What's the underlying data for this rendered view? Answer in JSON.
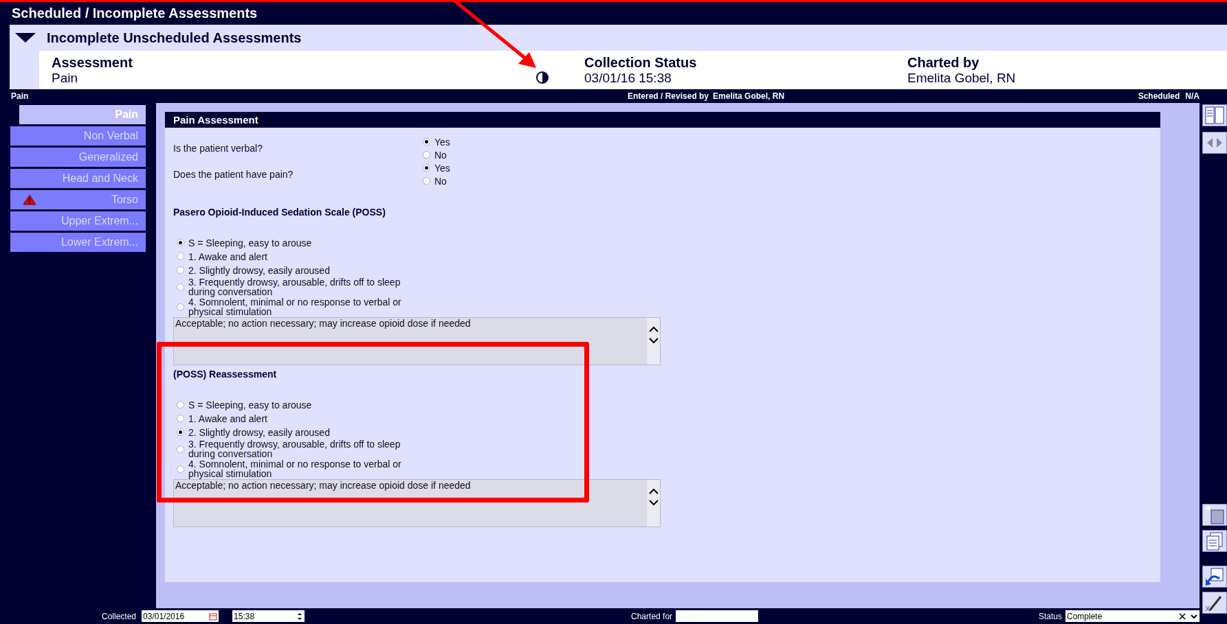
{
  "window": {
    "title": "Scheduled / Incomplete Assessments"
  },
  "section": {
    "title": "Incomplete Unscheduled Assessments",
    "expanded": true,
    "columns": [
      {
        "header": "Assessment",
        "value": "Pain"
      },
      {
        "header": "Collection Status",
        "value": "03/01/16 15:38"
      },
      {
        "header": "Charted by",
        "value": "Emelita Gobel, RN"
      }
    ]
  },
  "info_bar": {
    "title": "Pain",
    "entered_label": "Entered / Revised by",
    "entered_by": "Emelita Gobel, RN",
    "scheduled_label": "Scheduled",
    "scheduled_value": "N/A"
  },
  "sidebar": {
    "items": [
      {
        "label": "Pain",
        "selected": true,
        "warning": false
      },
      {
        "label": "Non Verbal",
        "selected": false,
        "warning": false
      },
      {
        "label": "Generalized",
        "selected": false,
        "warning": false
      },
      {
        "label": "Head and Neck",
        "selected": false,
        "warning": false
      },
      {
        "label": "Torso",
        "selected": false,
        "warning": true
      },
      {
        "label": "Upper Extrem...",
        "selected": false,
        "warning": false
      },
      {
        "label": "Lower Extrem...",
        "selected": false,
        "warning": false
      }
    ]
  },
  "form": {
    "title": "Pain Assessment",
    "questions": [
      {
        "label": "Is the patient verbal?",
        "options": [
          {
            "label": "Yes",
            "selected": true
          },
          {
            "label": "No",
            "selected": false
          }
        ]
      },
      {
        "label": "Does the patient have pain?",
        "options": [
          {
            "label": "Yes",
            "selected": true
          },
          {
            "label": "No",
            "selected": false
          }
        ]
      }
    ],
    "scales": [
      {
        "title": "Pasero Opioid-Induced Sedation Scale (POSS)",
        "options": [
          {
            "label": "S = Sleeping, easy to arouse",
            "selected": true
          },
          {
            "label": "1. Awake and alert",
            "selected": false
          },
          {
            "label": "2. Slightly drowsy, easily aroused",
            "selected": false
          },
          {
            "label": "3. Frequently drowsy, arousable, drifts off to sleep during conversation",
            "selected": false
          },
          {
            "label": "4. Somnolent, minimal or no response to verbal or physical stimulation",
            "selected": false
          }
        ],
        "comment": "Acceptable; no action necessary; may increase opioid dose if needed"
      },
      {
        "title": "(POSS) Reassessment",
        "options": [
          {
            "label": "S = Sleeping, easy to arouse",
            "selected": false
          },
          {
            "label": "1. Awake and alert",
            "selected": false
          },
          {
            "label": "2. Slightly drowsy, easily aroused",
            "selected": true
          },
          {
            "label": "3. Frequently drowsy, arousable, drifts off to sleep during conversation",
            "selected": false
          },
          {
            "label": "4. Somnolent, minimal or no response to verbal or physical stimulation",
            "selected": false
          }
        ],
        "comment": "Acceptable; no action necessary; may increase opioid dose if needed"
      }
    ]
  },
  "footer": {
    "collected_label": "Collected",
    "date": "03/01/2016",
    "time": "15:38",
    "charted_for_label": "Charted for",
    "status_label": "Status",
    "status": "Complete"
  },
  "annotations": {
    "arrow": true,
    "highlight_frame": true
  }
}
